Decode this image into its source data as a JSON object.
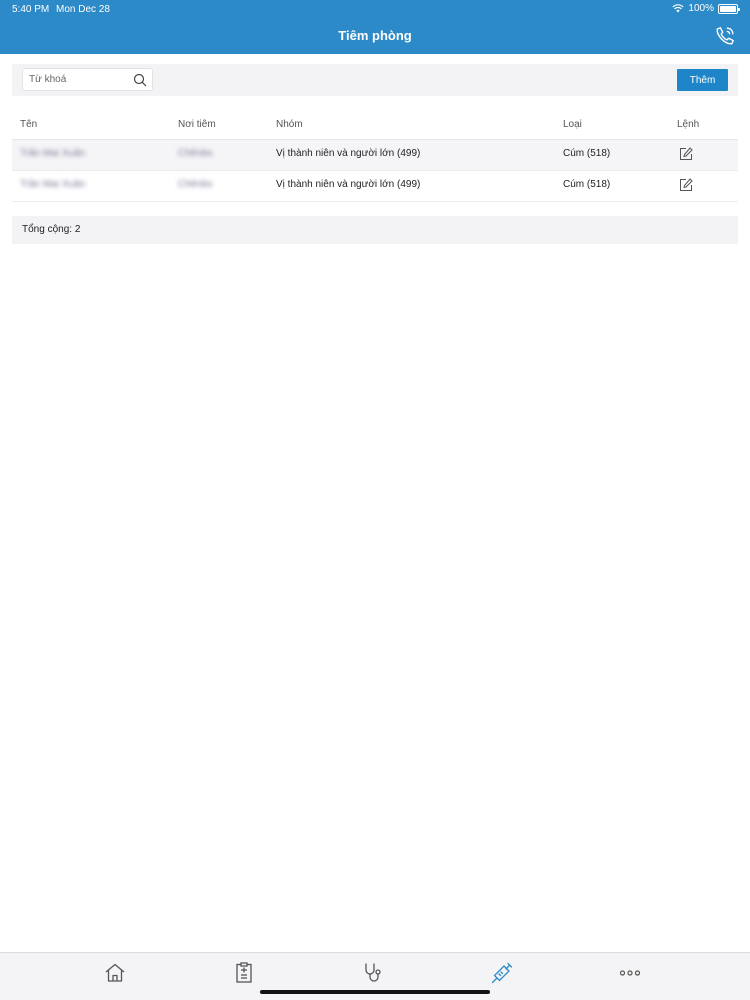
{
  "status": {
    "time": "5:40 PM",
    "date": "Mon Dec 28",
    "battery": "100%",
    "battery_level": 1.0
  },
  "header": {
    "title": "Tiêm phòng",
    "call_icon": "phone-call-icon"
  },
  "toolbar": {
    "search_placeholder": "Từ khoá",
    "search_value": "",
    "add_label": "Thêm"
  },
  "table": {
    "columns": [
      "Tên",
      "Nơi tiêm",
      "Nhóm",
      "Loại",
      "Lệnh"
    ],
    "rows": [
      {
        "name": "Trần Mai Xuân",
        "place": "Chênbs",
        "group": "Vị thành niên và người lớn (499)",
        "type": "Cúm (518)"
      },
      {
        "name": "Trần Mai Xuân",
        "place": "Chênbs",
        "group": "Vị thành niên và người lớn (499)",
        "type": "Cúm (518)"
      }
    ]
  },
  "footer": {
    "total": "Tổng cộng: 2"
  },
  "tabbar": {
    "items": [
      {
        "icon": "home-icon"
      },
      {
        "icon": "clipboard-icon"
      },
      {
        "icon": "stethoscope-icon"
      },
      {
        "icon": "syringe-icon",
        "active": true
      },
      {
        "icon": "more-icon"
      }
    ],
    "active_color": "#2c8ac8",
    "inactive_color": "#555555"
  }
}
